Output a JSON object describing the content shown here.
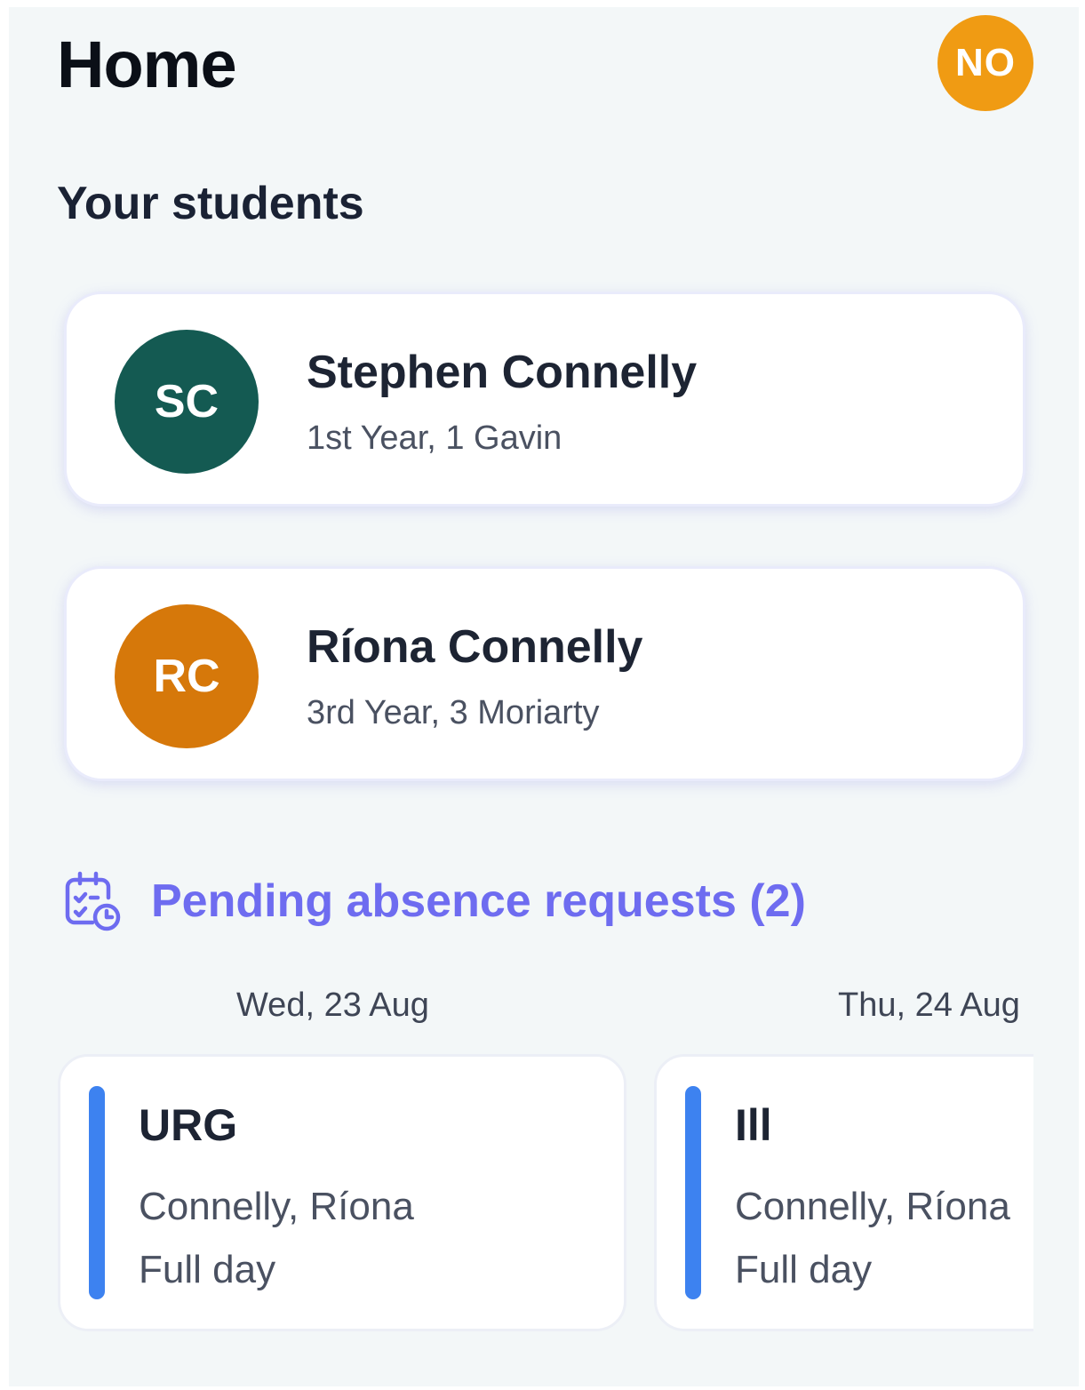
{
  "header": {
    "title": "Home",
    "profile_initials": "NO",
    "profile_color": "#f09b13"
  },
  "students": {
    "section_title": "Your students",
    "items": [
      {
        "initials": "SC",
        "name": "Stephen Connelly",
        "class_info": "1st Year, 1 Gavin",
        "avatar_color": "#145a52"
      },
      {
        "initials": "RC",
        "name": "Ríona Connelly",
        "class_info": "3rd Year, 3 Moriarty",
        "avatar_color": "#d6780a"
      }
    ]
  },
  "pending": {
    "icon": "calendar-clock-icon",
    "title": "Pending absence requests (2)",
    "accent_color": "#6e6cf0",
    "requests": [
      {
        "date": "Wed, 23 Aug",
        "type": "URG",
        "student": "Connelly, Ríona",
        "duration": "Full day"
      },
      {
        "date": "Thu, 24 Aug",
        "type": "Ill",
        "student": "Connelly, Ríona",
        "duration": "Full day"
      }
    ]
  }
}
